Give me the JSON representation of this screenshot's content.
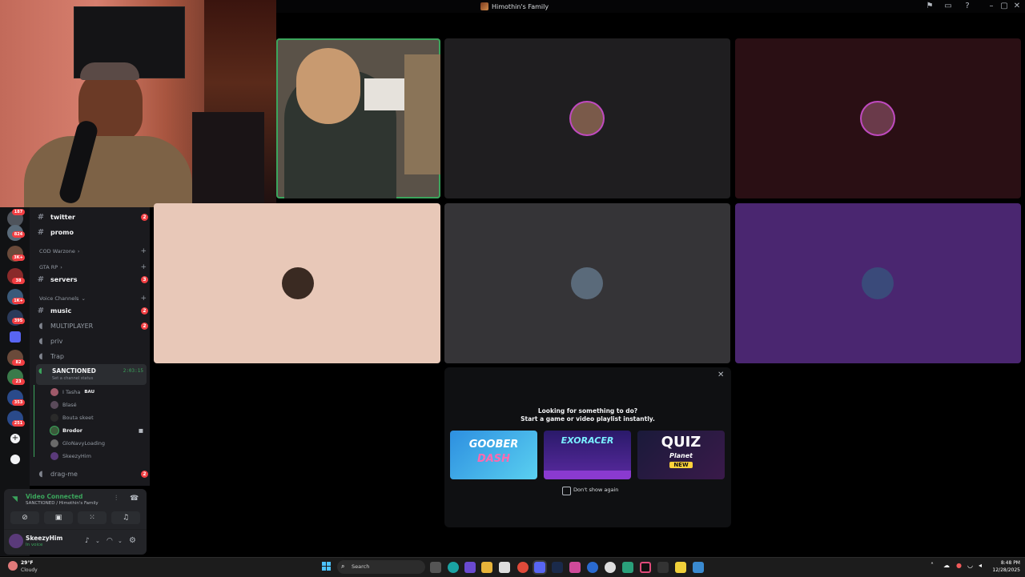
{
  "titlebar": {
    "title": "Himothin's Family"
  },
  "sidebar": {
    "channels_top": [
      {
        "label": "twitter",
        "badge": "2"
      },
      {
        "label": "promo",
        "badge": ""
      }
    ],
    "category_cod": "COD Warzone",
    "category_gta": "GTA RP",
    "gta_channels": [
      {
        "label": "servers",
        "badge": "3"
      }
    ],
    "category_voice": "Voice Channels",
    "voice_channels": [
      {
        "label": "music",
        "badge": "2",
        "type": "text"
      },
      {
        "label": "MULTIPLAYER",
        "badge": "2",
        "type": "voice"
      },
      {
        "label": "priv",
        "badge": "",
        "type": "voice"
      },
      {
        "label": "Trap",
        "badge": "",
        "type": "voice"
      }
    ],
    "active_channel": {
      "label": "SANCTIONED",
      "timer": "2:03:15",
      "status_placeholder": "Set a channel status"
    },
    "voice_users": [
      {
        "name": "I Tasha",
        "tag": "BAU"
      },
      {
        "name": "Blasé",
        "tag": ""
      },
      {
        "name": "Bouta skeet",
        "tag": ""
      },
      {
        "name": "Brodor",
        "tag": ""
      },
      {
        "name": "GloNavyLoading",
        "tag": ""
      },
      {
        "name": "SkeezyHim",
        "tag": ""
      }
    ],
    "after_channel": {
      "label": "drag-me",
      "badge": "2"
    },
    "server_badges": [
      "187",
      "824",
      "3K+",
      "38",
      "1K+",
      "395",
      "82",
      "23",
      "353",
      "251"
    ]
  },
  "voice_panel": {
    "status": "Video Connected",
    "location": "SANCTIONED / Himothin's Family"
  },
  "user_panel": {
    "username": "SkeezyHim",
    "status": "In voice"
  },
  "activity": {
    "heading": "Looking for something to do?",
    "subheading": "Start a game or video playlist instantly.",
    "games": [
      {
        "title_line1": "GOOBER",
        "title_line2": "DASH"
      },
      {
        "title_line1": "EXORACER",
        "title_line2": ""
      },
      {
        "title_line1": "QUIZ",
        "title_line2": "Planet",
        "badge": "NEW"
      }
    ],
    "checkbox_label": "Don't show again"
  },
  "taskbar": {
    "weather_temp": "29°F",
    "weather_desc": "Cloudy",
    "search_placeholder": "Search",
    "time": "8:48 PM",
    "date": "12/28/2025"
  },
  "colors": {
    "tile_dark_gray": "#1f1e20",
    "tile_maroon": "#2a0f14",
    "tile_peach": "#e8c8b8",
    "tile_gray": "#353437",
    "tile_purple": "#4a2670",
    "speaking_green": "#3ba55c",
    "brand": "#5865f2"
  }
}
